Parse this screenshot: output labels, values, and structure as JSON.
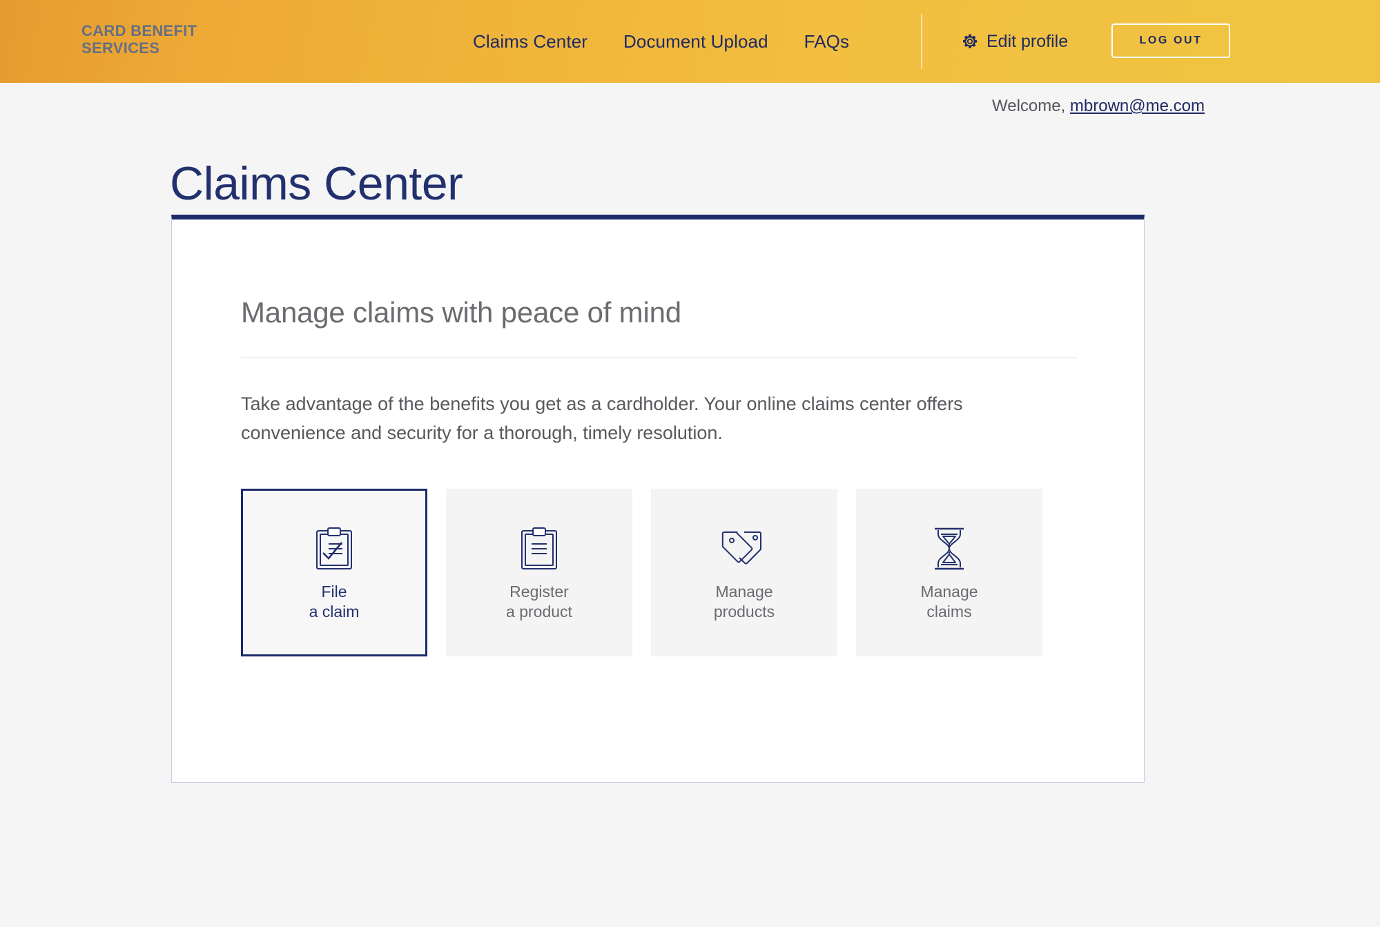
{
  "brand": {
    "logo_text": "CARD BENEFIT\nSERVICES",
    "logo_color": "#5a6b8c",
    "header_gradient_start": "#e69b2e",
    "header_gradient_end": "#f0c441",
    "navy": "#1b2a6b"
  },
  "header": {
    "nav": [
      {
        "label": "Claims Center",
        "name": "nav-claims-center"
      },
      {
        "label": "Document Upload",
        "name": "nav-document-upload"
      },
      {
        "label": "FAQs",
        "name": "nav-faqs"
      }
    ],
    "edit_profile_label": "Edit profile",
    "edit_profile_icon": "gear-icon",
    "logout_label": "LOG OUT"
  },
  "welcome": {
    "prefix": "Welcome, ",
    "email": "mbrown@me.com"
  },
  "page": {
    "title": "Claims Center"
  },
  "card": {
    "section_title": "Manage claims with peace of mind",
    "intro": "Take advantage of the benefits you get as a cardholder. Your online claims center offers convenience and security for a thorough, timely resolution.",
    "tiles": [
      {
        "label": "File\na claim",
        "icon": "clipboard-check-icon",
        "name": "tile-file-a-claim",
        "selected": true
      },
      {
        "label": "Register\na product",
        "icon": "clipboard-lines-icon",
        "name": "tile-register-a-product",
        "selected": false
      },
      {
        "label": "Manage\nproducts",
        "icon": "price-tags-icon",
        "name": "tile-manage-products",
        "selected": false
      },
      {
        "label": "Manage\nclaims",
        "icon": "hourglass-icon",
        "name": "tile-manage-claims",
        "selected": false
      }
    ]
  }
}
